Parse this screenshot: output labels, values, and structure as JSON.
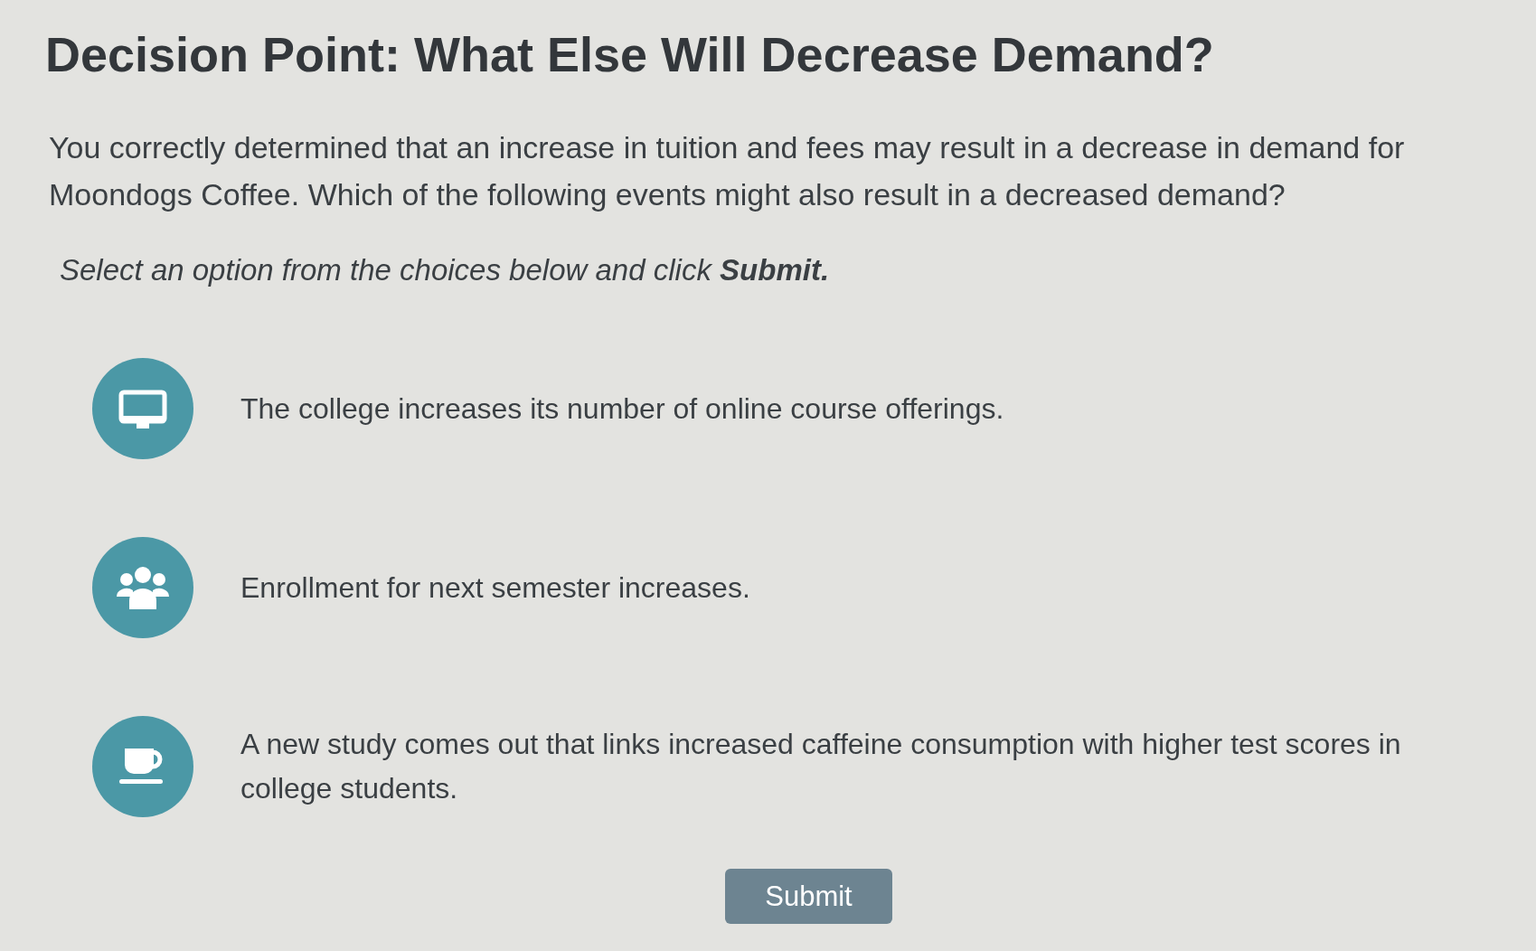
{
  "heading": "Decision Point: What Else Will Decrease Demand?",
  "prompt": "You correctly determined that an increase in tuition and fees may result in a decrease in demand for Moondogs Coffee. Which of the following events might also result in a decreased demand?",
  "instruction": "Select an option from the choices below and click **Submit.**",
  "options": [
    {
      "text": "The college increases its number of online course offerings.",
      "selected": false
    },
    {
      "text": "Enrollment for next semester increases.",
      "selected": false
    },
    {
      "text": "A new study comes out that links increased caffeine consumption with higher test scores in college students.",
      "selected": false
    }
  ],
  "submit_button": {
    "label": "Submit"
  }
}
